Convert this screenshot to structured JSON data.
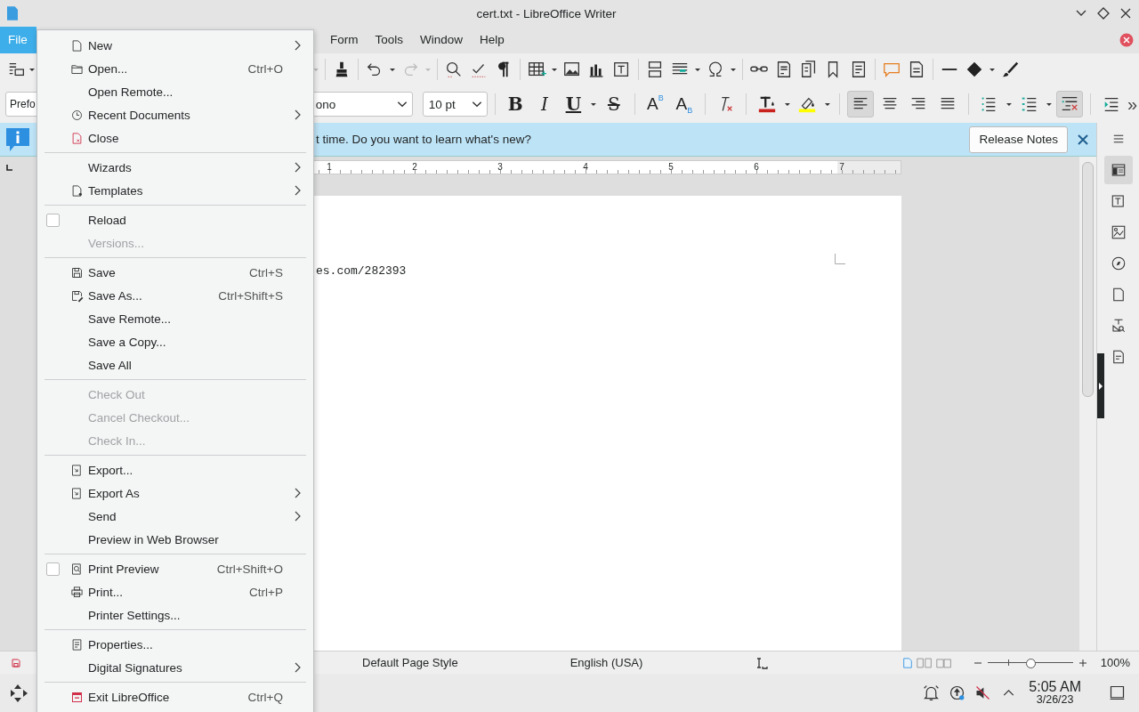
{
  "window": {
    "title": "cert.txt - LibreOffice Writer"
  },
  "menubar": [
    {
      "label": "File",
      "selected": true
    },
    {
      "label": "Form",
      "selected": false
    },
    {
      "label": "Tools",
      "selected": false
    },
    {
      "label": "Window",
      "selected": false
    },
    {
      "label": "Help",
      "selected": false
    }
  ],
  "format_toolbar": {
    "paragraph_style": "Prefo",
    "font_name": "ono",
    "font_size": "10 pt",
    "overflow": "»",
    "buttons": [
      {
        "kind": "bold",
        "text": "B",
        "selected": false
      },
      {
        "kind": "italic",
        "text": "I",
        "selected": false
      },
      {
        "kind": "underline",
        "text": "U",
        "selected": false,
        "dropdown": true
      },
      {
        "kind": "strike",
        "text": "S",
        "selected": false
      },
      {
        "kind": "superscript",
        "text": "A",
        "index": "B",
        "selected": false
      },
      {
        "kind": "subscript",
        "text": "A",
        "index": "B",
        "selected": false
      },
      {
        "kind": "clear",
        "selected": false
      },
      {
        "kind": "font-color",
        "selected": false,
        "dropdown": true
      },
      {
        "kind": "highlight",
        "selected": false,
        "dropdown": true
      },
      {
        "kind": "align-left",
        "selected": true
      },
      {
        "kind": "align-center",
        "selected": false
      },
      {
        "kind": "align-right",
        "selected": false
      },
      {
        "kind": "justify",
        "selected": false
      },
      {
        "kind": "bullets",
        "selected": false,
        "dropdown": true
      },
      {
        "kind": "numbering",
        "selected": false,
        "dropdown": true
      },
      {
        "kind": "outline",
        "selected": true
      },
      {
        "kind": "indent",
        "selected": false
      }
    ]
  },
  "infobar": {
    "message": "t time. Do you want to learn what's new?",
    "button": "Release Notes"
  },
  "ruler": {
    "labels": [
      "1",
      "2",
      "3",
      "4",
      "5",
      "6",
      "7"
    ]
  },
  "document": {
    "lines": [
      "es.com/282393"
    ]
  },
  "sidebar": [
    {
      "kind": "menu",
      "selected": false
    },
    {
      "kind": "properties",
      "selected": true
    },
    {
      "kind": "styles",
      "selected": false
    },
    {
      "kind": "gallery",
      "selected": false
    },
    {
      "kind": "navigator",
      "selected": false
    },
    {
      "kind": "page",
      "selected": false
    },
    {
      "kind": "inspector",
      "selected": false
    },
    {
      "kind": "changes",
      "selected": false
    }
  ],
  "status_bar": {
    "page_style": "Default Page Style",
    "language": "English (USA)",
    "zoom": {
      "level": 0.5,
      "value": "100%"
    }
  },
  "file_menu": {
    "sections": [
      {
        "items": [
          {
            "kind": "command",
            "label": "New",
            "submenu": true,
            "disabled": false
          },
          {
            "kind": "command",
            "label": "Open...",
            "shortcut": "Ctrl+O",
            "submenu": false,
            "disabled": false
          },
          {
            "kind": "command",
            "label": "Open Remote...",
            "submenu": false,
            "disabled": false
          },
          {
            "kind": "command",
            "label": "Recent Documents",
            "submenu": true,
            "disabled": false
          },
          {
            "kind": "command",
            "label": "Close",
            "submenu": false,
            "disabled": false
          }
        ]
      },
      {
        "items": [
          {
            "kind": "command",
            "label": "Wizards",
            "submenu": true,
            "disabled": false
          },
          {
            "kind": "command",
            "label": "Templates",
            "submenu": true,
            "disabled": false
          }
        ]
      },
      {
        "items": [
          {
            "kind": "check",
            "label": "Reload",
            "checked": false,
            "submenu": false,
            "disabled": false
          },
          {
            "kind": "command",
            "label": "Versions...",
            "submenu": false,
            "disabled": true
          }
        ]
      },
      {
        "items": [
          {
            "kind": "command",
            "label": "Save",
            "shortcut": "Ctrl+S",
            "submenu": false,
            "disabled": false
          },
          {
            "kind": "command",
            "label": "Save As...",
            "shortcut": "Ctrl+Shift+S",
            "submenu": false,
            "disabled": false
          },
          {
            "kind": "command",
            "label": "Save Remote...",
            "submenu": false,
            "disabled": false
          },
          {
            "kind": "command",
            "label": "Save a Copy...",
            "submenu": false,
            "disabled": false
          },
          {
            "kind": "command",
            "label": "Save All",
            "submenu": false,
            "disabled": false
          }
        ]
      },
      {
        "items": [
          {
            "kind": "command",
            "label": "Check Out",
            "submenu": false,
            "disabled": true
          },
          {
            "kind": "command",
            "label": "Cancel Checkout...",
            "submenu": false,
            "disabled": true
          },
          {
            "kind": "command",
            "label": "Check In...",
            "submenu": false,
            "disabled": true
          }
        ]
      },
      {
        "items": [
          {
            "kind": "command",
            "label": "Export...",
            "submenu": false,
            "disabled": false
          },
          {
            "kind": "command",
            "label": "Export As",
            "submenu": true,
            "disabled": false
          },
          {
            "kind": "command",
            "label": "Send",
            "submenu": true,
            "disabled": false
          },
          {
            "kind": "command",
            "label": "Preview in Web Browser",
            "submenu": false,
            "disabled": false
          }
        ]
      },
      {
        "items": [
          {
            "kind": "check",
            "label": "Print Preview",
            "checked": false,
            "shortcut": "Ctrl+Shift+O",
            "submenu": false,
            "disabled": false
          },
          {
            "kind": "command",
            "label": "Print...",
            "shortcut": "Ctrl+P",
            "submenu": false,
            "disabled": false
          },
          {
            "kind": "command",
            "label": "Printer Settings...",
            "submenu": false,
            "disabled": false
          }
        ]
      },
      {
        "items": [
          {
            "kind": "command",
            "label": "Properties...",
            "submenu": false,
            "disabled": false
          },
          {
            "kind": "command",
            "label": "Digital Signatures",
            "submenu": true,
            "disabled": false
          }
        ]
      },
      {
        "items": [
          {
            "kind": "command",
            "label": "Exit LibreOffice",
            "shortcut": "Ctrl+Q",
            "submenu": false,
            "disabled": false
          }
        ]
      }
    ]
  },
  "taskbar": {
    "time": "5:05 AM",
    "date": "3/26/23"
  }
}
